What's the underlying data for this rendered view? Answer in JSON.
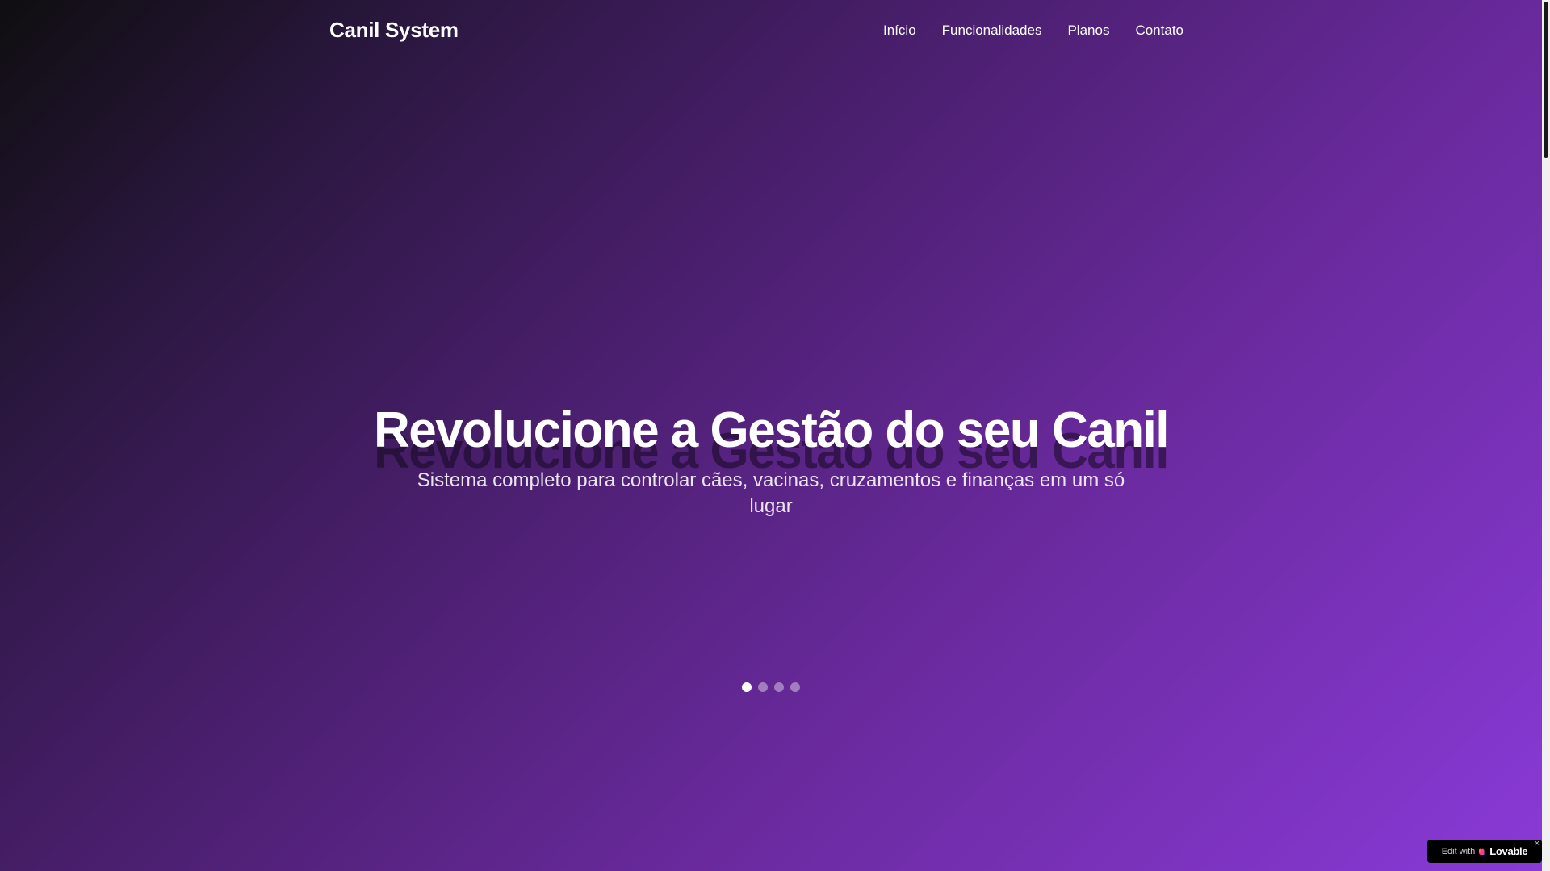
{
  "header": {
    "brand": "Canil System",
    "nav": [
      {
        "label": "Início"
      },
      {
        "label": "Funcionalidades"
      },
      {
        "label": "Planos"
      },
      {
        "label": "Contato"
      }
    ]
  },
  "hero": {
    "title": "Revolucione a Gestão do seu Canil",
    "subtitle": "Sistema completo para controlar cães, vacinas, cruzamentos e finanças em um só lugar"
  },
  "carousel": {
    "slide_count": 4,
    "active_index": 0
  },
  "badge": {
    "edit_label": "Edit with",
    "brand_label": "Lovable",
    "close_label": "×",
    "heart_icon": "heart-icon"
  },
  "colors": {
    "gradient_start": "#0f0e10",
    "gradient_end": "#8a3ad8",
    "text": "#ffffff"
  }
}
